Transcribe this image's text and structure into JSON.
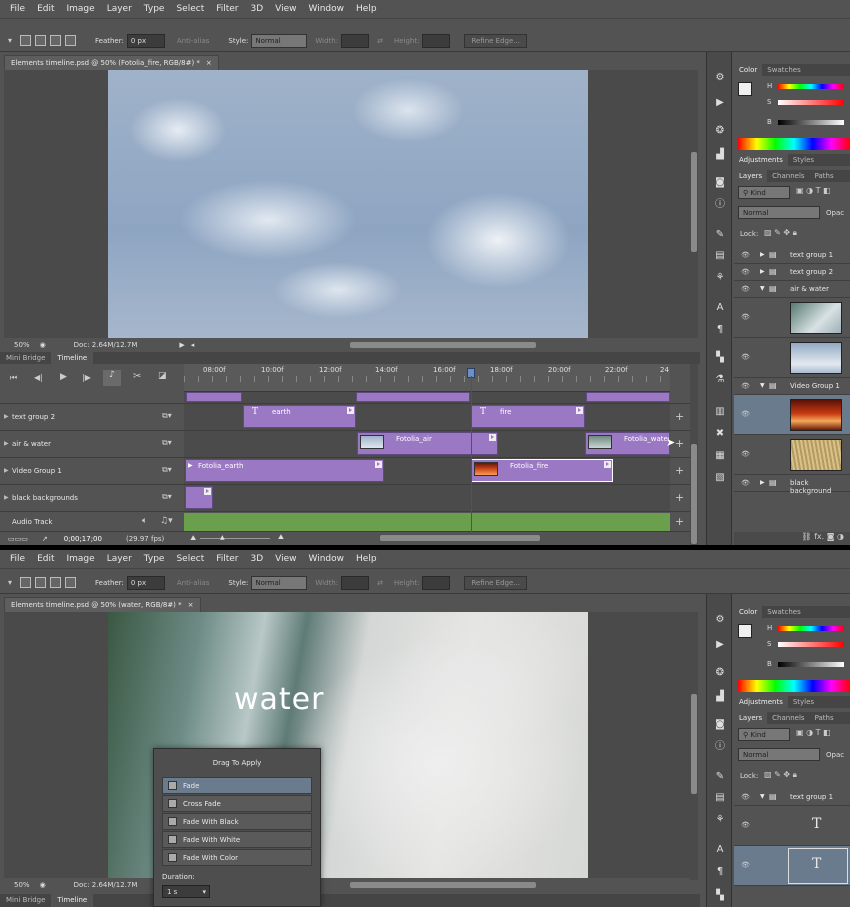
{
  "menu": [
    "File",
    "Edit",
    "Image",
    "Layer",
    "Type",
    "Select",
    "Filter",
    "3D",
    "View",
    "Window",
    "Help"
  ],
  "options": {
    "feather_label": "Feather:",
    "feather_value": "0 px",
    "antialias_label": "Anti-alias",
    "style_label": "Style:",
    "style_value": "Normal",
    "width_label": "Width:",
    "height_label": "Height:",
    "refine_button": "Refine Edge..."
  },
  "top": {
    "doc_tab": "Elements timeline.psd @ 50% (Fotolia_fire, RGB/8#) *",
    "zoom": "50%",
    "doc_size": "Doc: 2.64M/12.7M"
  },
  "bottom": {
    "doc_tab": "Elements timeline.psd @ 50% (water, RGB/8#) *",
    "zoom": "50%",
    "doc_size": "Doc: 2.64M/12.7M",
    "canvas_text": "water"
  },
  "panel_tabs": {
    "color": "Color",
    "swatches": "Swatches",
    "adjustments": "Adjustments",
    "styles": "Styles",
    "layers": "Layers",
    "channels": "Channels",
    "paths": "Paths",
    "kind": "Kind",
    "blend": "Normal",
    "opacity": "Opac",
    "lock": "Lock:",
    "color_h": "H",
    "color_s": "S",
    "color_b": "B"
  },
  "layers_top": [
    {
      "name": "text group 1",
      "type": "group",
      "collapsed": true
    },
    {
      "name": "text group 2",
      "type": "group",
      "collapsed": true
    },
    {
      "name": "air & water",
      "type": "group",
      "collapsed": false
    },
    {
      "name": "",
      "type": "thumb-waterfall"
    },
    {
      "name": "",
      "type": "thumb-clouds"
    },
    {
      "name": "Video Group 1",
      "type": "group",
      "collapsed": false
    },
    {
      "name": "",
      "type": "thumb-fire"
    },
    {
      "name": "",
      "type": "thumb-earth"
    },
    {
      "name": "black background",
      "type": "group",
      "collapsed": true
    }
  ],
  "layers_bottom": [
    {
      "name": "text group 1",
      "type": "group"
    },
    {
      "name": "",
      "type": "text-layer"
    },
    {
      "name": "",
      "type": "text-layer"
    }
  ],
  "timeline": {
    "tabs": [
      "Mini Bridge",
      "Timeline"
    ],
    "ruler": [
      "08:00f",
      "10:00f",
      "12:00f",
      "14:00f",
      "16:00f",
      "18:00f",
      "20:00f",
      "22:00f",
      "24"
    ],
    "timecode": "0;00;17;00",
    "fps": "(29.97 fps)",
    "audio_track": "Audio Track",
    "tracks": [
      {
        "name": "text group 2"
      },
      {
        "name": "air & water"
      },
      {
        "name": "Video Group 1"
      },
      {
        "name": "black backgrounds"
      }
    ],
    "clips": {
      "earth_text": "earth",
      "fire_text": "fire",
      "fotolia_air": "Fotolia_air",
      "fotolia_water": "Fotolia_water",
      "fotolia_earth": "Fotolia_earth",
      "fotolia_fire": "Fotolia_fire"
    }
  },
  "drag_panel": {
    "title": "Drag To Apply",
    "items": [
      "Fade",
      "Cross Fade",
      "Fade With Black",
      "Fade With White",
      "Fade With Color"
    ],
    "duration_label": "Duration:",
    "duration_value": "1 s"
  },
  "bottom_tabs": [
    "Mini Bridge",
    "Timeline"
  ],
  "colors": {
    "ui": "#535353",
    "clip": "#9b78c4",
    "audio": "#6aa04d",
    "playhead": "#c8202a"
  }
}
